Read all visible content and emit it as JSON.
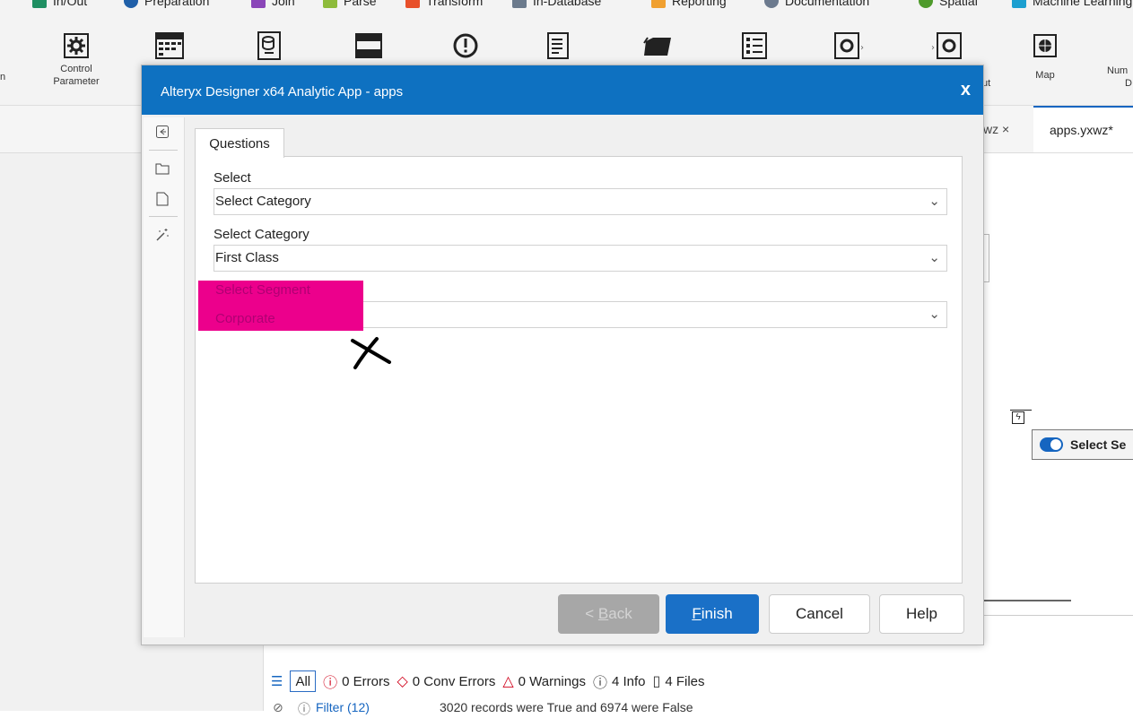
{
  "categories": [
    {
      "label": "In/Out",
      "color": "#1f8f62"
    },
    {
      "label": "Preparation",
      "color": "#1f5fa8"
    },
    {
      "label": "Join",
      "color": "#8a46b8"
    },
    {
      "label": "Parse",
      "color": "#8dbb3b"
    },
    {
      "label": "Transform",
      "color": "#e8502a"
    },
    {
      "label": "In-Database",
      "color": "#6b7a8c"
    },
    {
      "label": "Reporting",
      "color": "#f0a030"
    },
    {
      "label": "Documentation",
      "color": "#6c7a8e"
    },
    {
      "label": "Spatial",
      "color": "#4e9a2b"
    },
    {
      "label": "Machine Learning",
      "color": "#1c9fd0"
    }
  ],
  "ribbon": {
    "left_cut_label": "on",
    "control_parameter": [
      "Control",
      "Parameter"
    ],
    "right_cut_label": "ut",
    "map": "Map",
    "num_cut": [
      "Num",
      "D"
    ]
  },
  "doc_tabs": {
    "inactive": "wz ×",
    "active": "apps.yxwz*"
  },
  "canvas": {
    "select_pill": "Select Se"
  },
  "results": {
    "filters": {
      "all": "All",
      "errors": "0 Errors",
      "conv_errors": "0 Conv Errors",
      "warnings": "0 Warnings",
      "info": "4 Info",
      "files": "4 Files"
    },
    "row_tool": "Filter (12)",
    "row_message": "3020 records were True and 6974 were False"
  },
  "dialog": {
    "title": "Alteryx Designer x64 Analytic App - apps",
    "close": "x",
    "tab": "Questions",
    "fields": [
      {
        "label": "Select",
        "value": "Select Category"
      },
      {
        "label": "Select Category",
        "value": "First Class"
      },
      {
        "label": "Select Segment",
        "value": "Corporate"
      }
    ],
    "buttons": {
      "back": "< Back",
      "finish": "Finish",
      "cancel": "Cancel",
      "help": "Help"
    }
  }
}
